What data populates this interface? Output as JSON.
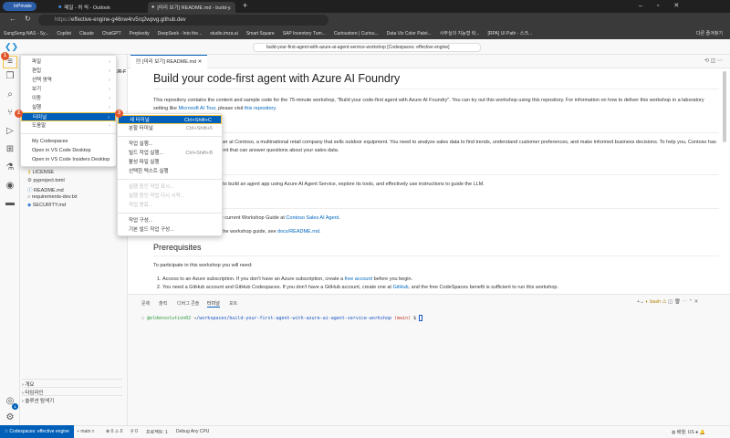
{
  "browser": {
    "inprivate": "InPrivate",
    "tabs": [
      {
        "title": "메일 - 허 씩 - Outlook"
      },
      {
        "title": "[미리 보기] README.md - build-y..."
      }
    ],
    "url_prefix": "https://",
    "url": "effective-engine-g46nw4rv5rq2wpvg.github.dev",
    "bookmarks": [
      "SangSeng-NAS - Sy...",
      "Copilot",
      "Claude",
      "ChatGPT",
      "Perplexity",
      "DeepSeek - Into the...",
      "studio.imza.ai",
      "Smart Square",
      "SAP Inventory Tum...",
      "Curioustore | Curiou...",
      "Data Viz Color Palet...",
      "사무실의 지능형 락...",
      "[RPA] UI Path - 스크...",
      "다른 즐겨찾기"
    ]
  },
  "vscode": {
    "command_center": "build-your-first-agent-with-azure-ai-agent-service-workshop [Codespaces: effective engine]",
    "sidebar": {
      "header": "BUILD-YOUR-FIRST-AGEN...",
      "files": [
        {
          "name": "LICENSE",
          "icon": "license-icon"
        },
        {
          "name": "pyproject.toml",
          "icon": "gear-icon"
        },
        {
          "name": "README.md",
          "icon": "info-icon"
        },
        {
          "name": "requirements-dev.txt",
          "icon": "text-file-icon"
        },
        {
          "name": "SECURITY.md",
          "icon": "markdown-icon"
        }
      ],
      "sections": [
        "개요",
        "타임라인",
        "솔루션 탐색기"
      ]
    },
    "editor_tab": "[미리 보기] README.md",
    "readme": {
      "title": "Build your code-first agent with Azure AI Foundry",
      "intro": "This repository contains the content and sample code for the 75-minute workshop, \"Build your code-first agent with Azure AI Foundry\". You can try out this workshop using this repository. For information on how to deliver this workshop in a laboratory setting like ",
      "link_ai_tour": "Microsoft AI Tour",
      "intro_mid": ", please visit ",
      "link_repo": "this repository",
      "intro_end": ".",
      "scenario": "Imagine you are a sales manager at Contoso, a multinational retail company that sells outdoor equipment. You need to analyze sales data to find trends, understand customer preferences, and make informed business decisions. To help you, Contoso has developed a conversational agent that can answer questions about your sales data.",
      "learn": "In this workshop, you will learn to build an agent app using Azure AI Agent Service, explore its tools, and effectively use instructions to guide the LLM.",
      "guide_pre": "To start the workshop, open the current Workshop Guide at ",
      "link_guide": "Contoso Sales AI Agent",
      "guide_end": ".",
      "more_pre": "For more information on using the workshop guide, see ",
      "link_docs": "docs/README.md",
      "more_end": ".",
      "prereq_heading": "Prerequisites",
      "prereq_intro": "To participate in this workshop you will need:",
      "prereq_1_pre": "Access to an Azure subscription. If you don't have an Azure subscription, create a ",
      "link_free": "free account",
      "prereq_1_end": " before you begin.",
      "prereq_2_pre": "You need a GitHub account and GitHub Codespaces. If you don't have a GitHub account, create one at ",
      "link_github": "GitHub",
      "prereq_2_end": ", and the free CodeSpaces benefit is sufficient to run this workshop."
    },
    "panel": {
      "tabs": [
        "문제",
        "출력",
        "디버그 콘솔",
        "터미널",
        "포트"
      ],
      "shell": "bash",
      "user": "@eldensolution02",
      "arrow": "→",
      "path": "/workspaces/build-your-first-agent-with-azure-ai-agent-service-workshop",
      "branch": "(main)",
      "dollar": "$"
    },
    "menu": {
      "items": [
        "파일",
        "편집",
        "선택 영역",
        "보기",
        "이동",
        "실행",
        "터미널",
        "도움말"
      ],
      "extra": [
        "My Codespaces",
        "Open in VS Code Desktop",
        "Open in VS Code Insiders Desktop"
      ]
    },
    "terminal_menu": [
      {
        "label": "새 터미널",
        "shortcut": "Ctrl+Shift+C"
      },
      {
        "label": "분할 터미널",
        "shortcut": "Ctrl+Shift+5"
      },
      {
        "label": "작업 실행..."
      },
      {
        "label": "빌드 작업 실행...",
        "shortcut": "Ctrl+Shift+B"
      },
      {
        "label": "활성 파일 실행"
      },
      {
        "label": "선택한 텍스트 실행"
      },
      {
        "label": "실행 중인 작업 표시..."
      },
      {
        "label": "실행 중인 작업 다시 시작..."
      },
      {
        "label": "작업 종료..."
      },
      {
        "label": "작업 구성..."
      },
      {
        "label": "기본 빌드 작업 구성..."
      }
    ],
    "steps": [
      "1",
      "2",
      "3"
    ],
    "status": {
      "remote": "Codespaces: effective engine",
      "branch": "main",
      "errors": "0",
      "warnings": "0",
      "ports": "0",
      "projects": "프로젝트: 1",
      "config": "Debug Any CPU",
      "layout": "배열: US",
      "account_badge": "1"
    }
  },
  "colors": {
    "accent": "#005fb8",
    "highlight": "#f5c542",
    "step_badge": "#e2562c"
  }
}
